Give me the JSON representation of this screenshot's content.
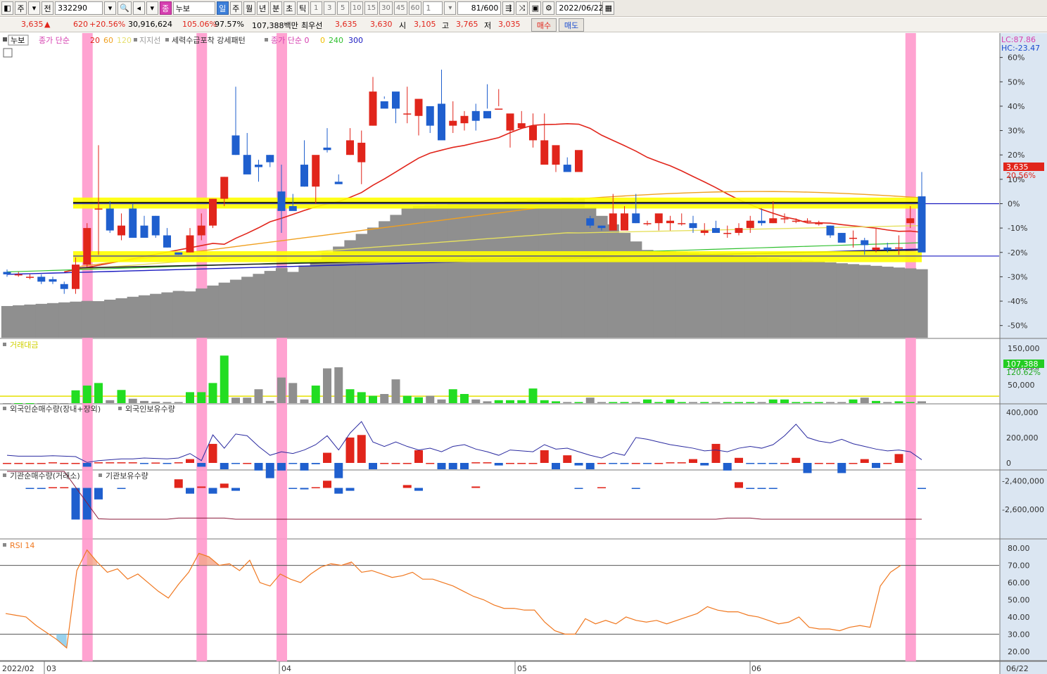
{
  "toolbar": {
    "code": "332290",
    "market_btn": "주",
    "prev_btn": "전",
    "name_badge": "종",
    "stock_name": "누보",
    "periods": [
      "일",
      "주",
      "월",
      "년",
      "분",
      "초",
      "틱"
    ],
    "active_period": "일",
    "intervals": [
      "1",
      "3",
      "5",
      "10",
      "15",
      "30",
      "45",
      "60"
    ],
    "custom_interval": "1",
    "count": "81",
    "count_max": "/600",
    "date": "2022/06/22"
  },
  "info": {
    "price": "3,635",
    "arrow": "▲",
    "change": "620",
    "change_rate": "+20.56%",
    "volume": "30,916,624",
    "vol_ratio": "105.06%",
    "turnover": "97.57%",
    "amount": "107,388백만",
    "best_bid_label": "최우선",
    "best_ask": "3,635",
    "best_bid": "3,630",
    "open_label": "시",
    "open": "3,105",
    "high_label": "고",
    "high": "3,765",
    "low_label": "저",
    "low": "3,035",
    "buy_btn": "매수",
    "sell_btn": "매도"
  },
  "legends": {
    "main_tag": "누보",
    "main": "종가 단순",
    "ma_periods": [
      "20",
      "60",
      "120"
    ],
    "support": "지지선",
    "pattern": "세력수급포착 강세패턴",
    "main2": "종가 단순 0",
    "ma2_periods": [
      "0",
      "240",
      "300"
    ],
    "lc": "LC:87.86",
    "hc": "HC:-23.47",
    "amount": "거래대금",
    "foreign": "외국인순매수량(장내+장외)",
    "foreign_hold": "외국인보유수량",
    "inst": "기관순매수량(거래소)",
    "inst_hold": "기관보유수량",
    "rsi": "RSI 14"
  },
  "colors": {
    "up": "#e1251b",
    "down": "#1f5fce",
    "highlight": "#ff99cc",
    "band": "#ffff00",
    "ma20": "#e1251b",
    "ma60": "#f0a020",
    "ma120": "#ffff40",
    "rsi": "#f07820"
  },
  "chart_data": [
    {
      "type": "candlestick",
      "panel": "price",
      "ylabel_unit": "%",
      "ylim": [
        -55,
        70
      ],
      "ticks": [
        "60%",
        "50%",
        "40%",
        "30%",
        "20%",
        "10%",
        "0%",
        "-10%",
        "-20%",
        "-30%",
        "-40%",
        "-50%"
      ],
      "last_price_label": "3,635",
      "last_change_label": "20.56%",
      "candles_pct": [
        [
          -28,
          -27,
          -30,
          -29
        ],
        [
          -29,
          -28,
          -30,
          -29
        ],
        [
          -30,
          -29,
          -31,
          -30
        ],
        [
          -30,
          -29,
          -33,
          -32
        ],
        [
          -31,
          -30,
          -33,
          -32
        ],
        [
          -33,
          -32,
          -37,
          -35
        ],
        [
          -35,
          -22,
          -37,
          -25
        ],
        [
          -25,
          -8,
          -26,
          -10
        ],
        [
          -2,
          24,
          -21,
          -2
        ],
        [
          -2,
          1,
          -12,
          -11
        ],
        [
          -13,
          -4,
          -15,
          -9
        ],
        [
          -2,
          0,
          -14,
          -14
        ],
        [
          -9,
          -5,
          -14,
          -14
        ],
        [
          -5,
          -5,
          -14,
          -13
        ],
        [
          -13,
          -10,
          -18,
          -18
        ],
        [
          -20,
          -20,
          -21,
          -21
        ],
        [
          -20,
          -10,
          -20,
          -13
        ],
        [
          -13,
          -4,
          -15,
          -9
        ],
        [
          -9,
          2,
          -10,
          2
        ],
        [
          2,
          11,
          -1,
          11
        ],
        [
          28,
          48,
          20,
          20
        ],
        [
          20,
          29,
          16,
          12
        ],
        [
          16,
          18,
          9,
          15
        ],
        [
          20,
          20,
          15,
          17
        ],
        [
          5,
          16,
          -12,
          -3
        ],
        [
          -1,
          4,
          -1,
          -3
        ],
        [
          16,
          26,
          7,
          7
        ],
        [
          7,
          14,
          0,
          20
        ],
        [
          23,
          31,
          21,
          22
        ],
        [
          9,
          12,
          9,
          8
        ],
        [
          20,
          31,
          20,
          26
        ],
        [
          17,
          30,
          8,
          25
        ],
        [
          32,
          52,
          32,
          46
        ],
        [
          42,
          43,
          44,
          39
        ],
        [
          46,
          42,
          33,
          39
        ],
        [
          37,
          48,
          33,
          37
        ],
        [
          36,
          43,
          28,
          43
        ],
        [
          40,
          36,
          29,
          32
        ],
        [
          41,
          55,
          41,
          26
        ],
        [
          32,
          42,
          29,
          34
        ],
        [
          33,
          38,
          30,
          36
        ],
        [
          38,
          41,
          30,
          34
        ],
        [
          38,
          49,
          39,
          35
        ],
        [
          39,
          47,
          40,
          39
        ],
        [
          30,
          36,
          23,
          37
        ],
        [
          31,
          38,
          32,
          33
        ],
        [
          26,
          37,
          23,
          32
        ],
        [
          16,
          37,
          18,
          26
        ],
        [
          16,
          23,
          13,
          24
        ],
        [
          16,
          19,
          14,
          13
        ],
        [
          13,
          18,
          15,
          22
        ],
        [
          -6,
          -5,
          -10,
          -9
        ],
        [
          -9,
          -9,
          -11,
          -10
        ],
        [
          -11,
          4,
          -10,
          -4
        ],
        [
          -11,
          -1,
          -10,
          -4
        ],
        [
          -4,
          4,
          -8,
          -8
        ],
        [
          -8,
          -7,
          -9,
          -8
        ],
        [
          -8,
          -6,
          -11,
          -4
        ],
        [
          -8,
          -5,
          -11,
          -7
        ],
        [
          -8,
          -4,
          -9,
          -8
        ],
        [
          -8,
          -5,
          -12,
          -10
        ],
        [
          -12,
          -8,
          -13,
          -11
        ],
        [
          -10,
          -7,
          -12,
          -12
        ],
        [
          -12,
          -9,
          -14,
          -12
        ],
        [
          -12,
          -8,
          -13,
          -10
        ],
        [
          -10,
          -5,
          -12,
          -7
        ],
        [
          -7,
          -2,
          -9,
          -8
        ],
        [
          -8,
          1,
          -8,
          -6
        ],
        [
          -6,
          -4,
          -8,
          -6
        ],
        [
          -7,
          -6,
          -8,
          -7
        ],
        [
          -7,
          -6,
          -8,
          -7
        ],
        [
          -8,
          -7,
          -9,
          -8
        ],
        [
          -9,
          -9,
          -14,
          -13
        ],
        [
          -12,
          -12,
          -16,
          -16
        ],
        [
          -14,
          -11,
          -18,
          -14
        ],
        [
          -15,
          -14,
          -21,
          -17
        ],
        [
          -19,
          -10,
          -20,
          -18
        ],
        [
          -18,
          -16,
          -20,
          -19
        ],
        [
          -18,
          -13,
          -21,
          -18
        ],
        [
          -8,
          -1,
          -10,
          -6
        ],
        [
          3,
          13,
          -1,
          -20
        ]
      ]
    },
    {
      "type": "bar",
      "panel": "amount",
      "ticks": [
        "150,000",
        "100,000",
        "50,000"
      ],
      "last_label": "107,388",
      "last_ratio_label": "120.62%",
      "ylim": [
        0,
        175000
      ]
    },
    {
      "type": "bar",
      "panel": "foreign",
      "ticks": [
        "400,000",
        "200,000",
        "0"
      ],
      "ylim": [
        -50000,
        460000
      ]
    },
    {
      "type": "bar",
      "panel": "institution",
      "ticks": [
        "-2,400,000",
        "-2,600,000"
      ],
      "ylim": [
        -2800000,
        -2330000
      ]
    },
    {
      "type": "line",
      "panel": "rsi",
      "name": "RSI 14",
      "ticks": [
        "80.00",
        "70.00",
        "60.00",
        "50.00",
        "40.00",
        "30.00",
        "20.00"
      ],
      "ylim": [
        15,
        85
      ],
      "values": [
        42,
        41,
        40,
        35,
        31,
        27,
        22,
        67,
        79,
        72,
        66,
        68,
        62,
        65,
        60,
        55,
        51,
        59,
        66,
        77,
        75,
        70,
        71,
        67,
        73,
        60,
        58,
        65,
        62,
        60,
        65,
        69,
        71,
        70,
        72,
        66,
        67,
        65,
        63,
        64,
        66,
        62,
        62,
        60,
        58,
        55,
        52,
        50,
        47,
        45,
        45,
        44,
        44,
        37,
        32,
        30,
        30,
        39,
        36,
        38,
        36,
        40,
        38,
        37,
        38,
        36,
        38,
        40,
        42,
        46,
        44,
        43,
        43,
        41,
        40,
        38,
        36,
        37,
        40,
        34,
        33,
        33,
        32,
        34,
        35,
        34,
        58,
        66,
        70
      ],
      "upper": 70,
      "lower": 30
    }
  ],
  "xaxis": {
    "labels": [
      "2022/02",
      "03",
      "04",
      "05",
      "06"
    ],
    "end_label": "06/22"
  }
}
